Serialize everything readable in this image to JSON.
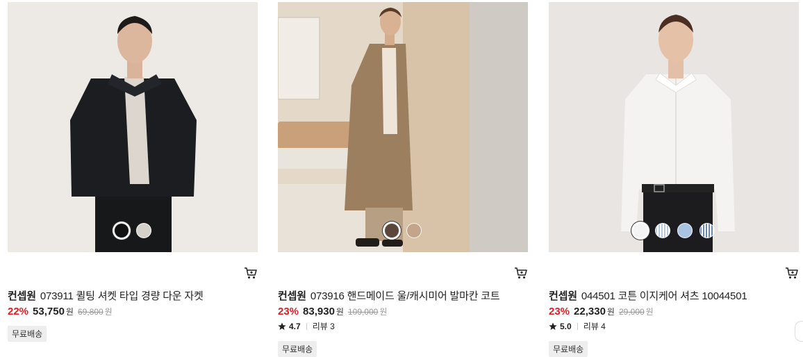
{
  "products": [
    {
      "brand": "컨셉원",
      "name": "073911 퀼팅 셔켓 타입 경량 다운 자켓",
      "discount": "22%",
      "price": "53,750",
      "currency": "원",
      "original_price": "69,800",
      "free_shipping": "무료배송",
      "swatches": [
        {
          "color": "#111111",
          "selected": true
        },
        {
          "color": "#d6d0ca",
          "selected": false
        }
      ]
    },
    {
      "brand": "컨셉원",
      "name": "073916 핸드메이드 울/캐시미어 발마칸 코트",
      "discount": "23%",
      "price": "83,930",
      "currency": "원",
      "original_price": "109,000",
      "rating": "4.7",
      "review_label": "리뷰 3",
      "free_shipping": "무료배송",
      "swatches": [
        {
          "color": "#5b463c",
          "selected": true
        },
        {
          "color": "#c4a58c",
          "selected": false
        }
      ]
    },
    {
      "brand": "컨셉원",
      "name": "044501 코튼 이지케어 셔츠 10044501",
      "discount": "23%",
      "price": "22,330",
      "currency": "원",
      "original_price": "29,000",
      "rating": "5.0",
      "review_label": "리뷰 4",
      "free_shipping": "무료배송",
      "swatches": [
        {
          "color": "#f4f4f4",
          "selected": true
        },
        {
          "color": "#b9c7dd",
          "pattern": "stripe",
          "selected": false
        },
        {
          "color": "#a9c3e3",
          "selected": false
        },
        {
          "color": "#6a86b5",
          "pattern": "stripe",
          "selected": false
        }
      ]
    }
  ],
  "icons": {
    "cart": "cart-icon",
    "star": "star-icon"
  },
  "colors": {
    "discount": "#e51c23",
    "badge_bg": "#eeeeee"
  }
}
